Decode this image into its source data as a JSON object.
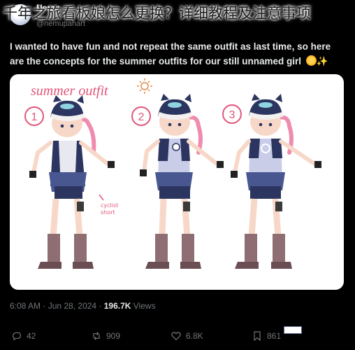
{
  "overlay_title": "千年之旅看板娘怎么更换？详细教程及注意事项",
  "author": {
    "name": "Nemu",
    "handle": "@nemupahart"
  },
  "tweet": {
    "text_line1": "I wanted to have fun and not repeat the same outfit as last time, so here",
    "text_line2": "are the concepts for the summer outfits for our still unnamed girl",
    "emoji": "sun-emoji",
    "sparkle": "✨"
  },
  "image": {
    "heading": "summer outfit",
    "labels": [
      "1",
      "2",
      "3"
    ],
    "annotation_line1": "cyclist",
    "annotation_line2": "short"
  },
  "meta": {
    "time": "6:08 AM · Jun 28, 2024 · ",
    "views": "196.7K",
    "views_label": " Views"
  },
  "actions": {
    "replies": "42",
    "reposts": "909",
    "likes": "6.8K",
    "bookmarks": "861"
  },
  "colors": {
    "background": "#000000",
    "text": "#e7e9ea",
    "muted": "#71767b",
    "heading_pink": "#e0567a"
  }
}
